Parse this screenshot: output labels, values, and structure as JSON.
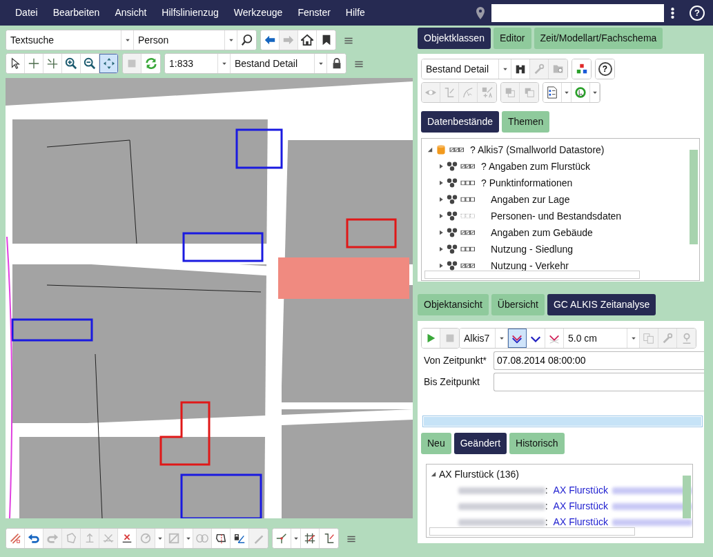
{
  "menu": [
    "Datei",
    "Bearbeiten",
    "Ansicht",
    "Hilfslinienzug",
    "Werkzeuge",
    "Fenster",
    "Hilfe"
  ],
  "menu_right": {
    "help_label": "?"
  },
  "search_bar": {
    "mode": "Textsuche",
    "object_class": "Person",
    "groups": [
      [
        {
          "kind": "search",
          "disabled": false
        }
      ],
      [
        {
          "kind": "arrow-left",
          "disabled": false
        },
        {
          "kind": "arrow-right",
          "disabled": true
        },
        {
          "kind": "home",
          "disabled": false
        },
        {
          "kind": "bookmark",
          "disabled": false
        }
      ]
    ]
  },
  "map_toolbar": {
    "tools": [
      {
        "kind": "cursor",
        "selected": false
      },
      {
        "kind": "crosshair",
        "selected": false
      },
      {
        "kind": "split-crosshair",
        "selected": false
      },
      {
        "kind": "zoom-in",
        "selected": false
      },
      {
        "kind": "zoom-out",
        "selected": false
      },
      {
        "kind": "pan",
        "selected": true
      }
    ],
    "actions": [
      {
        "kind": "stop",
        "disabled": true
      },
      {
        "kind": "refresh",
        "disabled": false
      }
    ],
    "scale": "1:833",
    "view": "Bestand Detail"
  },
  "edit_toolbar": [
    [
      {
        "kind": "slash-line",
        "disabled": false
      },
      {
        "kind": "undo",
        "disabled": false
      },
      {
        "kind": "redo",
        "disabled": true
      },
      {
        "kind": "polygon",
        "disabled": true
      },
      {
        "kind": "node-move",
        "disabled": true
      },
      {
        "kind": "cross-line",
        "disabled": true
      },
      {
        "kind": "delete-node",
        "disabled": false
      },
      {
        "kind": "circle",
        "disabled": true,
        "dropdown": true
      },
      {
        "kind": "square-slash",
        "disabled": true,
        "dropdown": true
      },
      {
        "kind": "chain",
        "disabled": true
      },
      {
        "kind": "polygon-edit",
        "disabled": false
      },
      {
        "kind": "lock-line",
        "disabled": false
      },
      {
        "kind": "pencil",
        "disabled": true
      }
    ],
    [
      {
        "kind": "branch",
        "disabled": false,
        "dropdown": true
      },
      {
        "kind": "grid",
        "disabled": false
      },
      {
        "kind": "corner-line",
        "disabled": false
      }
    ]
  ],
  "right_tabs": [
    {
      "label": "Objektklassen",
      "selected": true
    },
    {
      "label": "Editor",
      "selected": false
    },
    {
      "label": "Zeit/Modellart/Fachschema",
      "selected": false
    }
  ],
  "class_panel": {
    "view": "Bestand Detail",
    "row1": [
      [
        {
          "kind": "binoculars",
          "disabled": false
        },
        {
          "kind": "wrench",
          "disabled": true
        },
        {
          "kind": "folder-search",
          "disabled": true
        }
      ],
      [
        {
          "kind": "cubes",
          "disabled": false
        }
      ],
      [
        {
          "kind": "help",
          "label": "?",
          "disabled": false
        }
      ]
    ],
    "row2": [
      [
        {
          "kind": "eye",
          "disabled": true
        },
        {
          "kind": "corner-line",
          "disabled": true
        },
        {
          "kind": "curve",
          "disabled": true
        },
        {
          "kind": "swap",
          "disabled": true
        }
      ],
      [
        {
          "kind": "front",
          "disabled": true
        },
        {
          "kind": "back",
          "disabled": true
        }
      ],
      [
        {
          "kind": "checklist",
          "disabled": false,
          "dropdown": true
        },
        {
          "kind": "history",
          "disabled": false,
          "dropdown": true
        }
      ]
    ],
    "sub_tabs": [
      {
        "label": "Datenbestände",
        "selected": true
      },
      {
        "label": "Themen",
        "selected": false
      }
    ],
    "tree": [
      {
        "kind": "datastore",
        "mark": "?",
        "label": "Alkis7 (Smallworld Datastore)",
        "checked": true,
        "dimmed": false,
        "expanded": true,
        "children": [
          {
            "kind": "group",
            "mark": "?",
            "label": "Angaben zum Flurstück",
            "checked": true,
            "dimmed": false,
            "expanded": false
          },
          {
            "kind": "group",
            "mark": "?",
            "label": "Punktinformationen",
            "checked": false,
            "dimmed": false,
            "expanded": false
          },
          {
            "kind": "group",
            "label": "Angaben zur Lage",
            "checked": false,
            "dimmed": false,
            "expanded": false
          },
          {
            "kind": "group",
            "label": "Personen- und Bestandsdaten",
            "checked": false,
            "dimmed": true,
            "expanded": false
          },
          {
            "kind": "group",
            "label": "Angaben zum Gebäude",
            "checked": true,
            "dimmed": false,
            "expanded": false
          },
          {
            "kind": "group",
            "label": "Nutzung - Siedlung",
            "checked": false,
            "dimmed": false,
            "expanded": false
          },
          {
            "kind": "group",
            "label": "Nutzung - Verkehr",
            "checked": true,
            "dimmed": false,
            "expanded": false
          }
        ]
      }
    ]
  },
  "lower_tabs": [
    {
      "label": "Objektansicht",
      "selected": false
    },
    {
      "label": "Übersicht",
      "selected": false
    },
    {
      "label": "GC ALKIS Zeitanalyse",
      "selected": true
    }
  ],
  "analysis": {
    "actions": [
      {
        "kind": "play",
        "disabled": false
      },
      {
        "kind": "stop",
        "disabled": true
      }
    ],
    "source": "Alkis7",
    "modes": [
      {
        "kind": "chevrons-both",
        "selected": true
      },
      {
        "kind": "chevrons-blue",
        "selected": false
      },
      {
        "kind": "chevrons-red",
        "selected": false
      }
    ],
    "tolerance": "5.0 cm",
    "progress": {
      "level": 1
    },
    "extra": [
      {
        "kind": "copy",
        "disabled": true
      },
      {
        "kind": "wrench",
        "disabled": true
      },
      {
        "kind": "pin",
        "disabled": true
      }
    ],
    "fields": [
      {
        "label": "Von Zeitpunkt*",
        "value": "07.08.2014 08:00:00"
      },
      {
        "label": "Bis Zeitpunkt"
      }
    ],
    "filters": [
      {
        "label": "Neu",
        "selected": false
      },
      {
        "label": "Geändert",
        "selected": true
      },
      {
        "label": "Historisch",
        "selected": false
      }
    ],
    "results": {
      "label": "AX Flurstück (136)",
      "expanded": true,
      "children": [
        {
          "sep": ":",
          "link": "AX Flurstück"
        },
        {
          "sep": ":",
          "link": "AX Flurstück"
        },
        {
          "sep": ":",
          "link": "AX Flurstück"
        }
      ]
    }
  }
}
